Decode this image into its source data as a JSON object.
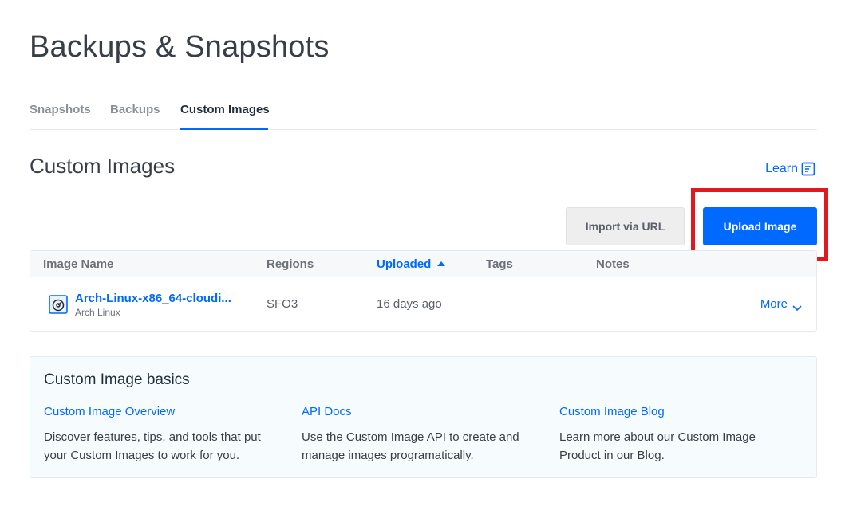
{
  "page": {
    "title": "Backups & Snapshots"
  },
  "tabs": [
    {
      "label": "Snapshots",
      "active": false
    },
    {
      "label": "Backups",
      "active": false
    },
    {
      "label": "Custom Images",
      "active": true
    }
  ],
  "section": {
    "title": "Custom Images",
    "learn_label": "Learn",
    "learn_icon": "document-icon"
  },
  "actions": {
    "import_label": "Import via URL",
    "upload_label": "Upload Image"
  },
  "table": {
    "headers": {
      "name": "Image Name",
      "regions": "Regions",
      "uploaded": "Uploaded",
      "tags": "Tags",
      "notes": "Notes"
    },
    "sorted_by": "Uploaded",
    "rows": [
      {
        "name": "Arch-Linux-x86_64-cloudi...",
        "distro": "Arch Linux",
        "region": "SFO3",
        "uploaded": "16 days ago",
        "tags": "",
        "notes": "",
        "more_label": "More",
        "icon": "disk-image-icon"
      }
    ]
  },
  "basics": {
    "title": "Custom Image basics",
    "columns": [
      {
        "link": "Custom Image Overview",
        "text": "Discover features, tips, and tools that put your Custom Images to work for you."
      },
      {
        "link": "API Docs",
        "text": "Use the Custom Image API to create and manage images programatically."
      },
      {
        "link": "Custom Image Blog",
        "text": "Learn more about our Custom Image Product in our Blog."
      }
    ]
  },
  "colors": {
    "accent": "#0069ff",
    "highlight": "#e0191e",
    "basics_bg": "#f6fbfe"
  }
}
